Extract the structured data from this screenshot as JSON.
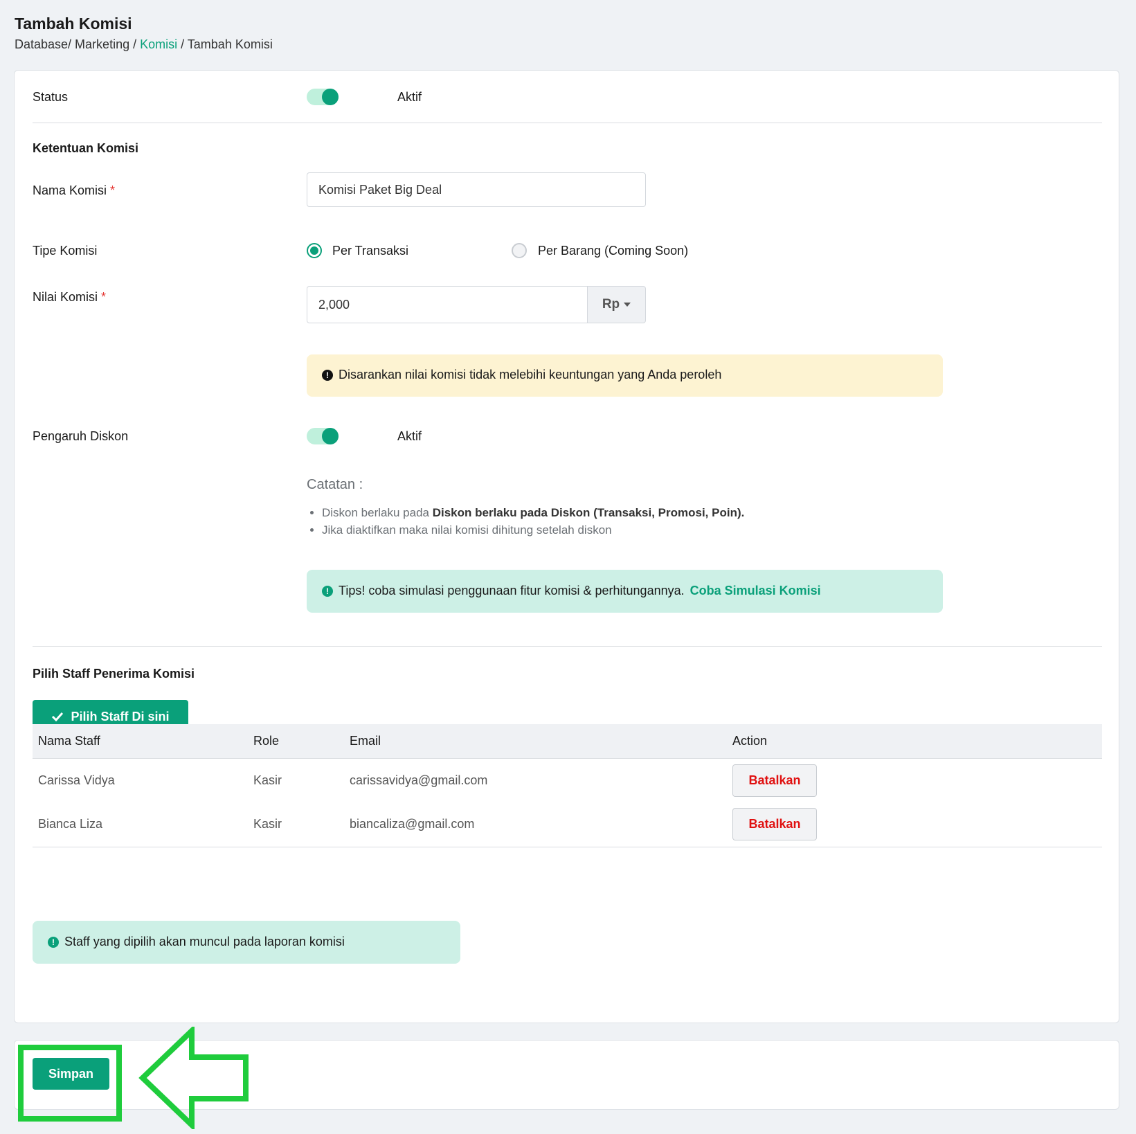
{
  "header": {
    "title": "Tambah Komisi",
    "breadcrumb": [
      {
        "label": "Database/ Marketing / ",
        "active": false
      },
      {
        "label": "Komisi",
        "active": true
      },
      {
        "label": " / Tambah Komisi",
        "active": false
      }
    ]
  },
  "form": {
    "status": {
      "label": "Status",
      "value_label": "Aktif",
      "enabled": true
    },
    "section_title": "Ketentuan Komisi",
    "nama_komisi": {
      "label": "Nama Komisi",
      "required_mark": "*",
      "value": "Komisi Paket Big Deal"
    },
    "tipe_komisi": {
      "label": "Tipe Komisi",
      "options": [
        {
          "label": "Per Transaksi",
          "selected": true
        },
        {
          "label": "Per Barang (Coming Soon)",
          "selected": false
        }
      ]
    },
    "nilai_komisi": {
      "label": "Nilai Komisi",
      "required_mark": "*",
      "value": "2,000",
      "currency": "Rp"
    },
    "warning": {
      "icon": "exclamation-circle-icon",
      "text": "Disarankan nilai komisi tidak melebihi keuntungan yang Anda peroleh"
    },
    "pengaruh_diskon": {
      "label": "Pengaruh Diskon",
      "value_label": "Aktif",
      "enabled": true
    },
    "notes": {
      "title": "Catatan :",
      "item1_prefix": "Diskon berlaku pada ",
      "item1_bold": "Diskon berlaku pada Diskon (Transaksi, Promosi, Poin).",
      "item2": "Jika diaktifkan maka nilai komisi dihitung setelah diskon"
    },
    "tips": {
      "icon": "exclamation-circle-icon",
      "text": "Tips! coba simulasi penggunaan fitur komisi & perhitungannya.",
      "link": "Coba Simulasi Komisi"
    }
  },
  "staff": {
    "section_title": "Pilih Staff Penerima Komisi",
    "select_button": "Pilih Staff Di sini",
    "columns": [
      "Nama Staff",
      "Role",
      "Email",
      "Action"
    ],
    "rows": [
      {
        "name": "Carissa Vidya",
        "role": "Kasir",
        "email": "carissavidya@gmail.com",
        "action": "Batalkan"
      },
      {
        "name": "Bianca Liza",
        "role": "Kasir",
        "email": "biancaliza@gmail.com",
        "action": "Batalkan"
      }
    ],
    "info": {
      "icon": "exclamation-circle-icon",
      "text": "Staff yang dipilih akan muncul pada laporan komisi"
    }
  },
  "footer": {
    "save_button": "Simpan"
  },
  "colors": {
    "accent": "#0aa07a",
    "danger": "#e01010",
    "highlight": "#1fcc3c"
  }
}
